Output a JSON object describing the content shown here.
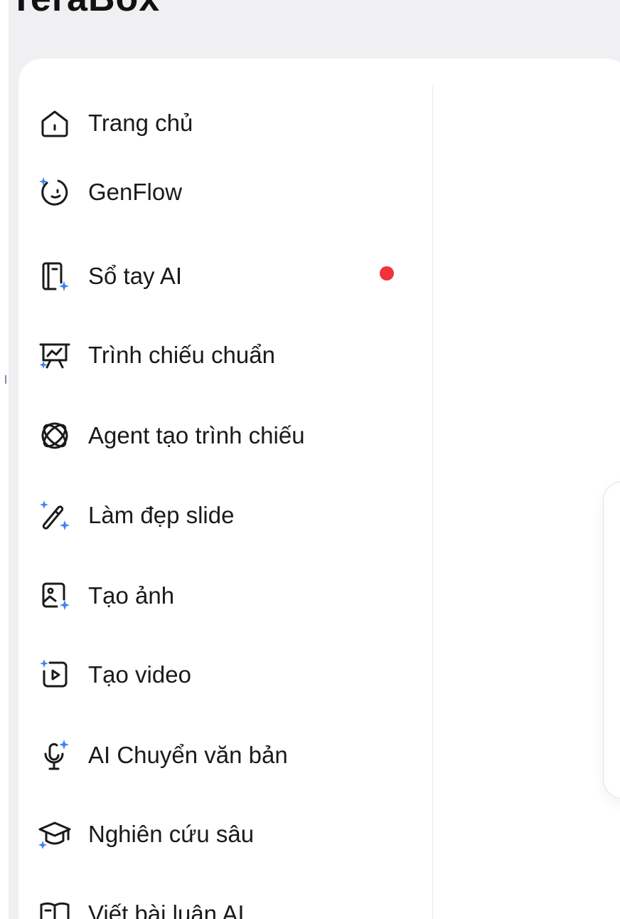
{
  "brand": {
    "name": "TeraBox"
  },
  "colors": {
    "accent": "#3b82f6",
    "badge": "#f2333a",
    "text": "#1a1a1a"
  },
  "sidebar": {
    "items": [
      {
        "label": "Trang chủ",
        "icon": "home-icon"
      },
      {
        "label": "GenFlow",
        "icon": "genflow-icon"
      },
      {
        "label": "Sổ tay AI",
        "icon": "notebook-icon",
        "has_badge": true
      },
      {
        "label": "Trình chiếu chuẩn",
        "icon": "presentation-icon"
      },
      {
        "label": "Agent tạo trình chiếu",
        "icon": "agent-atom-icon"
      },
      {
        "label": "Làm đẹp slide",
        "icon": "magic-wand-icon"
      },
      {
        "label": "Tạo ảnh",
        "icon": "image-icon"
      },
      {
        "label": "Tạo video",
        "icon": "video-icon"
      },
      {
        "label": "AI Chuyển văn bản",
        "icon": "microphone-icon"
      },
      {
        "label": "Nghiên cứu sâu",
        "icon": "graduation-cap-icon"
      },
      {
        "label": "Viết bài luận AI",
        "icon": "essay-book-icon"
      }
    ]
  }
}
